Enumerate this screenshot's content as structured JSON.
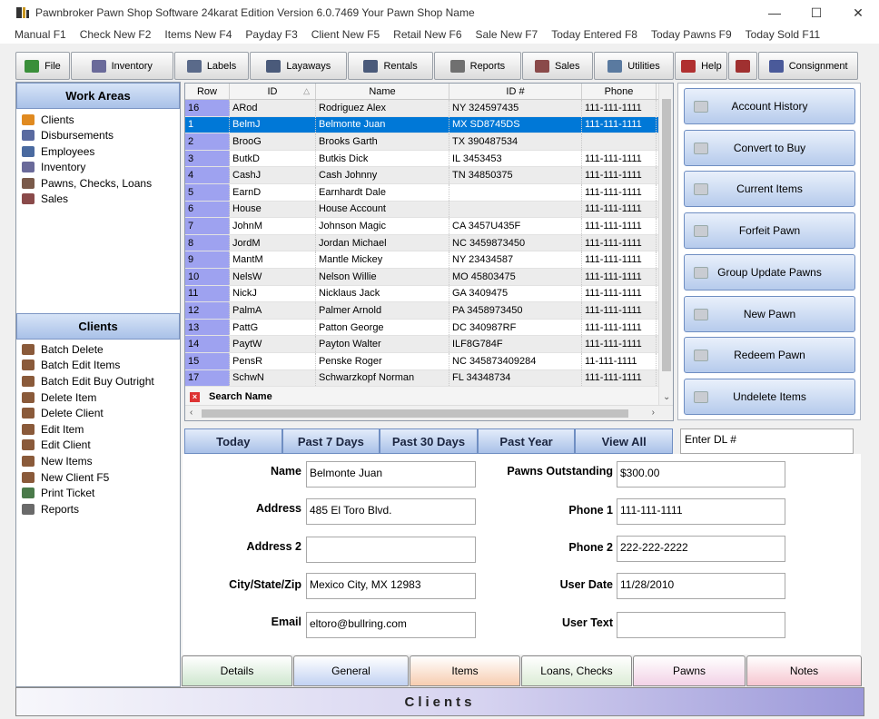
{
  "window": {
    "title": "Pawnbroker Pawn Shop Software 24karat Edition Version 6.0.7469 Your Pawn Shop Name",
    "minimize": "—",
    "maximize": "☐",
    "close": "✕"
  },
  "menu": [
    "Manual F1",
    "Check New  F2",
    "Items New F4",
    "Payday F3",
    "Client New F5",
    "Retail New F6",
    "Sale New F7",
    "Today Entered F8",
    "Today Pawns F9",
    "Today Sold F11"
  ],
  "toolbar": {
    "buttons": [
      {
        "label": "File",
        "icon": "file-icon",
        "color": "#3a8f3a"
      },
      {
        "label": "Inventory",
        "icon": "inventory-icon",
        "color": "#6a6a9a"
      },
      {
        "label": "Labels",
        "icon": "labels-icon",
        "color": "#5a6a8a"
      },
      {
        "label": "Layaways",
        "icon": "layaways-icon",
        "color": "#4a5a7a"
      },
      {
        "label": "Rentals",
        "icon": "rentals-icon",
        "color": "#4a5a7a"
      },
      {
        "label": "Reports",
        "icon": "reports-icon",
        "color": "#707070"
      },
      {
        "label": "Sales",
        "icon": "sales-icon",
        "color": "#8a4a4a"
      },
      {
        "label": "Utilities",
        "icon": "utilities-icon",
        "color": "#5a7aa0"
      },
      {
        "label": "Help",
        "icon": "help-icon",
        "color": "#b03030"
      },
      {
        "label": "",
        "icon": "check-icon",
        "color": "#a03030"
      },
      {
        "label": "Consignment",
        "icon": "consignment-icon",
        "color": "#4a5a9a"
      }
    ]
  },
  "work_areas": {
    "title": "Work Areas",
    "items": [
      {
        "label": "Clients",
        "icon": "clients-icon",
        "color": "#e08a20"
      },
      {
        "label": "Disbursements",
        "icon": "disbursements-icon",
        "color": "#5a6aa0"
      },
      {
        "label": "Employees",
        "icon": "employees-icon",
        "color": "#4a6aa0"
      },
      {
        "label": "Inventory",
        "icon": "inventory-icon",
        "color": "#6a6a9a"
      },
      {
        "label": "Pawns,  Checks,  Loans",
        "icon": "pawns-icon",
        "color": "#7a5a4a"
      },
      {
        "label": "Sales",
        "icon": "sales-icon",
        "color": "#8a4a4a"
      }
    ]
  },
  "clients_panel": {
    "title": "Clients",
    "items": [
      {
        "label": "Batch Delete",
        "icon": "batch-delete-icon",
        "color": "#8a5a3a"
      },
      {
        "label": "Batch Edit Items",
        "icon": "batch-edit-items-icon",
        "color": "#8a5a3a"
      },
      {
        "label": "Batch Edit Buy Outright",
        "icon": "batch-edit-buy-icon",
        "color": "#8a5a3a"
      },
      {
        "label": "Delete Item",
        "icon": "delete-item-icon",
        "color": "#8a5a3a"
      },
      {
        "label": "Delete Client",
        "icon": "delete-client-icon",
        "color": "#8a5a3a"
      },
      {
        "label": "Edit Item",
        "icon": "edit-item-icon",
        "color": "#8a5a3a"
      },
      {
        "label": "Edit Client",
        "icon": "edit-client-icon",
        "color": "#8a5a3a"
      },
      {
        "label": "New Items",
        "icon": "new-items-icon",
        "color": "#8a5a3a"
      },
      {
        "label": "New Client  F5",
        "icon": "new-client-icon",
        "color": "#8a5a3a"
      },
      {
        "label": "Print Ticket",
        "icon": "print-ticket-icon",
        "color": "#4a7a4a"
      },
      {
        "label": "Reports",
        "icon": "reports-icon",
        "color": "#6a6a6a"
      }
    ]
  },
  "grid": {
    "columns": [
      "Row",
      "ID",
      "Name",
      "ID #",
      "Phone"
    ],
    "sort_arrow": "△",
    "rows": [
      {
        "row": "16",
        "id": "ARod",
        "name": "Rodriguez Alex",
        "idn": "NY 324597435",
        "phone": "111-111-1111"
      },
      {
        "row": "1",
        "id": "BelmJ",
        "name": "Belmonte Juan",
        "idn": "MX SD8745DS",
        "phone": "111-111-1111",
        "selected": true
      },
      {
        "row": "2",
        "id": "BrooG",
        "name": "Brooks Garth",
        "idn": "TX 390487534",
        "phone": ""
      },
      {
        "row": "3",
        "id": "ButkD",
        "name": "Butkis Dick",
        "idn": "IL 3453453",
        "phone": "111-111-1111"
      },
      {
        "row": "4",
        "id": "CashJ",
        "name": "Cash Johnny",
        "idn": "TN 34850375",
        "phone": "111-111-1111"
      },
      {
        "row": "5",
        "id": "EarnD",
        "name": "Earnhardt Dale",
        "idn": "",
        "phone": "111-111-1111"
      },
      {
        "row": "6",
        "id": "House",
        "name": "House Account",
        "idn": "",
        "phone": "111-111-1111"
      },
      {
        "row": "7",
        "id": "JohnM",
        "name": "Johnson Magic",
        "idn": "CA 3457U435F",
        "phone": "111-111-1111"
      },
      {
        "row": "8",
        "id": "JordM",
        "name": "Jordan Michael",
        "idn": "NC 3459873450",
        "phone": "111-111-1111"
      },
      {
        "row": "9",
        "id": "MantM",
        "name": "Mantle Mickey",
        "idn": "NY 23434587",
        "phone": "111-111-1111"
      },
      {
        "row": "10",
        "id": "NelsW",
        "name": "Nelson Willie",
        "idn": "MO 45803475",
        "phone": "111-111-1111"
      },
      {
        "row": "11",
        "id": "NickJ",
        "name": "Nicklaus Jack",
        "idn": "GA 3409475",
        "phone": "111-111-1111"
      },
      {
        "row": "12",
        "id": "PalmA",
        "name": "Palmer Arnold",
        "idn": "PA 3458973450",
        "phone": "111-111-1111"
      },
      {
        "row": "13",
        "id": "PattG",
        "name": "Patton George",
        "idn": "DC 340987RF",
        "phone": "111-111-1111"
      },
      {
        "row": "14",
        "id": "PaytW",
        "name": "Payton Walter",
        "idn": "ILF8G784F",
        "phone": "111-111-1111"
      },
      {
        "row": "15",
        "id": "PensR",
        "name": "Penske Roger",
        "idn": "NC 345873409284",
        "phone": "11-111-1111"
      },
      {
        "row": "17",
        "id": "SchwN",
        "name": "Schwarzkopf Norman",
        "idn": "FL 34348734",
        "phone": "111-111-1111"
      }
    ],
    "search_label": "Search Name"
  },
  "actions": [
    {
      "label": "Account History",
      "name": "account-history-button"
    },
    {
      "label": "Convert to Buy",
      "name": "convert-to-buy-button"
    },
    {
      "label": "Current Items",
      "name": "current-items-button"
    },
    {
      "label": "Forfeit Pawn",
      "name": "forfeit-pawn-button"
    },
    {
      "label": "Group Update Pawns",
      "name": "group-update-pawns-button"
    },
    {
      "label": "New Pawn",
      "name": "new-pawn-button"
    },
    {
      "label": "Redeem Pawn",
      "name": "redeem-pawn-button"
    },
    {
      "label": "Undelete Items",
      "name": "undelete-items-button"
    }
  ],
  "filters": [
    "Today",
    "Past 7 Days",
    "Past 30 Days",
    "Past Year",
    "View All"
  ],
  "dl_input": {
    "value": "Enter DL #"
  },
  "form": {
    "name": {
      "label": "Name",
      "value": "Belmonte Juan"
    },
    "address": {
      "label": "Address",
      "value": "485 El Toro Blvd."
    },
    "address2": {
      "label": "Address 2",
      "value": ""
    },
    "city": {
      "label": "City/State/Zip",
      "value": "Mexico City, MX 12983"
    },
    "email": {
      "label": "Email",
      "value": "eltoro@bullring.com"
    },
    "pawns_outstanding": {
      "label": "Pawns Outstanding",
      "value": "$300.00"
    },
    "phone1": {
      "label": "Phone 1",
      "value": "111-111-1111"
    },
    "phone2": {
      "label": "Phone 2",
      "value": "222-222-2222"
    },
    "user_date": {
      "label": "User Date",
      "value": "11/28/2010"
    },
    "user_text": {
      "label": "User Text",
      "value": ""
    }
  },
  "tabs": [
    {
      "label": "Details",
      "color": "#cfe7cf"
    },
    {
      "label": "General",
      "color": "#c2d2f2"
    },
    {
      "label": "Items",
      "color": "#f7cdb0"
    },
    {
      "label": "Loans, Checks",
      "color": "#dcecd6"
    },
    {
      "label": "Pawns",
      "color": "#f2d2e6"
    },
    {
      "label": "Notes",
      "color": "#f6c6d0"
    }
  ],
  "status": {
    "label": "Clients"
  }
}
